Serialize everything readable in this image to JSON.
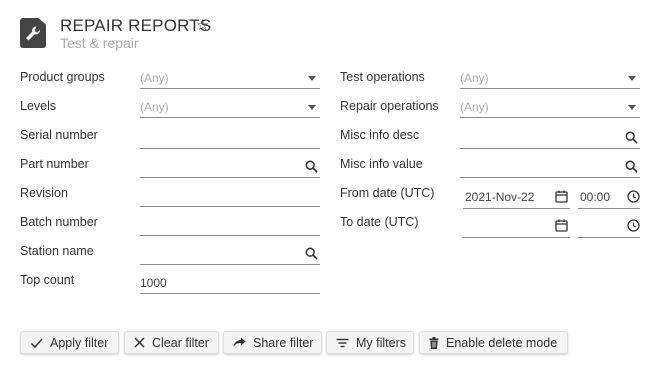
{
  "header": {
    "title": "REPAIR REPORTS",
    "subtitle": "Test & repair",
    "star_icon": "star-outline-icon",
    "app_icon": "wrench-document-icon"
  },
  "filters": {
    "product_groups": {
      "label": "Product groups",
      "value": "(Any)"
    },
    "levels": {
      "label": "Levels",
      "value": "(Any)"
    },
    "serial_number": {
      "label": "Serial number",
      "value": ""
    },
    "part_number": {
      "label": "Part number",
      "value": ""
    },
    "revision": {
      "label": "Revision",
      "value": ""
    },
    "batch_number": {
      "label": "Batch number",
      "value": ""
    },
    "station_name": {
      "label": "Station name",
      "value": ""
    },
    "top_count": {
      "label": "Top count",
      "value": "1000"
    },
    "test_operations": {
      "label": "Test operations",
      "value": "(Any)"
    },
    "repair_operations": {
      "label": "Repair operations",
      "value": "(Any)"
    },
    "misc_info_desc": {
      "label": "Misc info desc",
      "value": ""
    },
    "misc_info_value": {
      "label": "Misc info value",
      "value": ""
    },
    "from_date": {
      "label": "From date (UTC)",
      "date": "2021-Nov-22",
      "time": "00:00"
    },
    "to_date": {
      "label": "To date (UTC)",
      "date": "",
      "time": ""
    }
  },
  "buttons": {
    "apply": "Apply filter",
    "clear": "Clear filter",
    "share": "Share filter",
    "my_filters": "My filters",
    "delete_mode": "Enable delete mode"
  },
  "colors": {
    "text": "#333333",
    "subtitle": "#aaaaaa",
    "placeholder": "#aaaaaa",
    "underline": "#8a8a8a",
    "button_bg": "#f4f4f4"
  }
}
